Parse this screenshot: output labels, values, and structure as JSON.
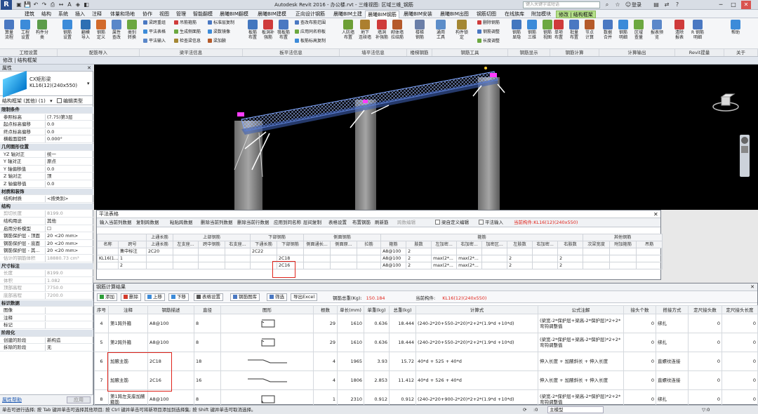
{
  "titlebar": {
    "app_title": "Autodesk Revit 2016 -",
    "doc_title": "办公楼.rvt - 三维视图: 区域三维_钢筋",
    "search_placeholder": "键入关键字或短语",
    "login": "登录",
    "quick_icons": [
      "open-icon",
      "save-icon",
      "undo-icon",
      "redo-icon",
      "print-icon",
      "measure-icon",
      "text-icon",
      "3d-icon",
      "section-icon"
    ]
  },
  "menu_tabs": [
    "建筑",
    "结构",
    "系统",
    "插入",
    "注释",
    "体量和场地",
    "协作",
    "视图",
    "管理",
    "智能翻模",
    "晨曦BIM翻模",
    "晨曦BIM建模",
    "正向设计钢筋",
    "晨曦BIM土建",
    "晨曦BIM钢筋",
    "晨曦BIM安装",
    "晨曦BIM出图",
    "钢筋切图",
    "在线族库",
    "附加模块",
    "修改 | 结构框架"
  ],
  "ribbon": {
    "big_buttons": [
      {
        "label": "算量\n流程",
        "color": "#4a78c2"
      },
      {
        "label": "工程\n设置",
        "color": "#3c8bd9"
      },
      {
        "label": "构件分类",
        "color": "#5c9c4a"
      },
      {
        "label": "钢筋\n设置",
        "color": "#3c8bd9"
      },
      {
        "label": "翻模\n导入",
        "color": "#2e6fb3"
      },
      {
        "label": "钢筋\n定义",
        "color": "#d26a2b"
      },
      {
        "label": "属性\n查改",
        "color": "#5a87c9"
      },
      {
        "label": "类别\n转换",
        "color": "#6ca840"
      },
      {
        "label": "板筋\n布置",
        "color": "#4377bf"
      },
      {
        "label": "板洞补\n强筋",
        "color": "#cf3b3b"
      },
      {
        "label": "筏板筋\n布置",
        "color": "#4a78c2"
      },
      {
        "label": "人防墙\n布置",
        "color": "#6d9f36"
      },
      {
        "label": "地下\n连续墙",
        "color": "#ac7f2f"
      },
      {
        "label": "墙洞\n补强筋",
        "color": "#cf3b3b"
      },
      {
        "label": "砌体墙\n拉结筋",
        "color": "#b55a2a"
      },
      {
        "label": "楼梯\n钢筋",
        "color": "#6b7fa8"
      },
      {
        "label": "通用\n工具",
        "color": "#5c8dc9"
      },
      {
        "label": "构件锁定",
        "color": "#a48733"
      },
      {
        "label": "钢筋\n显隐",
        "color": "#4377bf"
      },
      {
        "label": "钢筋\n三维",
        "color": "#3c8bd9"
      },
      {
        "label": "钢筋\n视图",
        "color": "#6ca840"
      },
      {
        "label": "单项\n布置",
        "color": "#cf3b3b"
      },
      {
        "label": "批量\n布置",
        "color": "#4a78c2"
      },
      {
        "label": "节点\n计算",
        "color": "#b55a2a"
      },
      {
        "label": "数据\n合并",
        "color": "#4a78c2"
      },
      {
        "label": "钢筋\n明细",
        "color": "#3c8bd9"
      },
      {
        "label": "区域\n查量",
        "color": "#6ca840"
      },
      {
        "label": "报表预览",
        "color": "#5a87c9"
      },
      {
        "label": "清除\n报表",
        "color": "#cf3b3b"
      },
      {
        "label": "R 钢筋明细",
        "color": "#4a78c2"
      },
      {
        "label": "帮助",
        "color": "#3c8bd9"
      }
    ],
    "small_buttons": [
      {
        "label": "梁跨重组",
        "color": "#4a78c2"
      },
      {
        "label": "平法表格",
        "color": "#3c8bd9"
      },
      {
        "label": "平法输入",
        "color": "#5a87c9"
      },
      {
        "label": "吊筋箍筋",
        "color": "#cf3b3b"
      },
      {
        "label": "生成侧面筋",
        "color": "#6ca840"
      },
      {
        "label": "检查梁信息",
        "color": "#a48733"
      },
      {
        "label": "标准层复制",
        "color": "#4a78c2"
      },
      {
        "label": "梁数镜像",
        "color": "#3c8bd9"
      },
      {
        "label": "梁加腋",
        "color": "#b55a2a"
      },
      {
        "label": "查改布筋范围",
        "color": "#4a78c2"
      },
      {
        "label": "应用同名称板",
        "color": "#6ca840"
      },
      {
        "label": "板筋标高复制",
        "color": "#3c8bd9"
      },
      {
        "label": "删除钢筋",
        "color": "#cf3b3b"
      },
      {
        "label": "钢筋调整",
        "color": "#4a78c2"
      },
      {
        "label": "长度调整",
        "color": "#6ca840"
      }
    ],
    "groups": [
      "工程设置",
      "配筋导入",
      "梁平法信息",
      "板平法信息",
      "墙平法信息",
      "楼梯钢筋",
      "钢筋工具",
      "钢筋显示",
      "钢筋计算",
      "计算输出",
      "Revit提量",
      "关于"
    ]
  },
  "context_bar": "修改 | 结构框架",
  "properties": {
    "title": "属性",
    "type_line1": "CX矩形梁",
    "type_line2": "KL16(12)(240x550)",
    "filter": "结构框架 (其他) (1)",
    "edit_type": "编辑类型",
    "rows": [
      {
        "label": "限制条件",
        "section": true
      },
      {
        "label": "参照标高",
        "value": "(7.75)第3层"
      },
      {
        "label": "起点标高偏移",
        "value": "0.0"
      },
      {
        "label": "终点标高偏移",
        "value": "0.0"
      },
      {
        "label": "横截面旋转",
        "value": "0.000°"
      },
      {
        "label": "几何图形位置",
        "section": true
      },
      {
        "label": "YZ 轴对正",
        "value": "统一"
      },
      {
        "label": "Y 轴对正",
        "value": "原点"
      },
      {
        "label": "Y 轴偏移值",
        "value": "0.0"
      },
      {
        "label": "Z 轴对正",
        "value": "顶"
      },
      {
        "label": "Z 轴偏移值",
        "value": "0.0"
      },
      {
        "label": "材质和装饰",
        "section": true
      },
      {
        "label": "结构材质",
        "value": "<按类别>"
      },
      {
        "label": "结构",
        "section": true
      },
      {
        "label": "剪切长度",
        "value": "8199.0",
        "dim": true
      },
      {
        "label": "结构用途",
        "value": "其他"
      },
      {
        "label": "启用分析模型",
        "value": "☐"
      },
      {
        "label": "钢筋保护层 - 顶面",
        "value": "20 <20 mm>"
      },
      {
        "label": "钢筋保护层 - 底面",
        "value": "20 <20 mm>"
      },
      {
        "label": "钢筋保护层 - 其...",
        "value": "20 <20 mm>"
      },
      {
        "label": "估计的钢筋体积",
        "value": "18880.73 cm³",
        "dim": true
      },
      {
        "label": "尺寸标注",
        "section": true
      },
      {
        "label": "长度",
        "value": "8199.0",
        "dim": true
      },
      {
        "label": "体积",
        "value": "1.082",
        "dim": true
      },
      {
        "label": "顶部高程",
        "value": "7750.0",
        "dim": true
      },
      {
        "label": "底部高程",
        "value": "7200.0",
        "dim": true
      },
      {
        "label": "标识数据",
        "section": true
      },
      {
        "label": "图像",
        "value": ""
      },
      {
        "label": "注释",
        "value": ""
      },
      {
        "label": "标记",
        "value": ""
      },
      {
        "label": "阶段化",
        "section": true
      },
      {
        "label": "创建的阶段",
        "value": "新构造"
      },
      {
        "label": "拆除的阶段",
        "value": "无"
      }
    ],
    "help_link": "属性帮助",
    "apply_button": "应用"
  },
  "table_panel": {
    "title": "平法表格",
    "toolbar": [
      "输入当前列数据",
      "复制跨数据",
      "粘贴跨数据",
      "删除当前列数据",
      "删除当前行数据",
      "应用到同名称",
      "层间复制",
      "表格设置",
      "布置钢筋",
      "刷新筋",
      "跨数编辑"
    ],
    "chk_custom": "梁自定义编辑",
    "chk_input": "平法输入",
    "current_prefix": "当前构件:",
    "current_member": "KL16(12)(240x550)",
    "groups": [
      "上通长筋",
      "上部钢筋",
      "下部钢筋",
      "侧面钢筋",
      "箍筋",
      "其他钢筋"
    ],
    "headers": [
      "名称",
      "跨号",
      "上通长筋",
      "左支座...",
      "跨中钢筋",
      "右支座...",
      "下通长筋",
      "下部钢筋",
      "侧面通长...",
      "侧面原...",
      "拉筋",
      "箍筋",
      "肢数",
      "左加密...",
      "右加密...",
      "加密区...",
      "左肢数",
      "右加密...",
      "右肢数",
      "次梁宽度",
      "附加箍筋",
      "吊筋"
    ],
    "rows": [
      [
        "",
        "集中标注",
        "2C20",
        "",
        "",
        "",
        "2C22",
        "",
        "",
        "",
        "",
        "A8@100",
        "2",
        "",
        "",
        "",
        "",
        "",
        "",
        "",
        "",
        ""
      ],
      [
        "KL16(1...",
        "1",
        "",
        "",
        "",
        "",
        "",
        "2C18",
        "",
        "",
        "",
        "A8@100",
        "2",
        "max(2*...",
        "max(2*...",
        "",
        "2",
        "",
        "2",
        "",
        "",
        ""
      ],
      [
        "",
        "2",
        "",
        "",
        "",
        "",
        "",
        "2C16",
        "",
        "",
        "",
        "A8@100",
        "2",
        "max(2*...",
        "max(2*...",
        "",
        "2",
        "",
        "2",
        "",
        "",
        ""
      ]
    ]
  },
  "result_panel": {
    "title": "钢筋计算结果",
    "buttons": [
      "添加",
      "删除",
      "上移",
      "下移",
      "表格设置",
      "钢筋图库",
      "筛选",
      "导出Excel"
    ],
    "total_weight_label": "钢筋总重(Kg):",
    "total_weight": "150.184",
    "current_label": "当前构件:",
    "current_member": "KL16(12)(240x550)",
    "headers": [
      "序号",
      "注释",
      "钢筋描述",
      "直径",
      "图形",
      "根数",
      "单长(mm)",
      "单重(kg)",
      "总重(kg)",
      "计算式",
      "公式注解",
      "接头个数",
      "搭接方式",
      "定尺接头数",
      "定尺接头长度"
    ],
    "rows": [
      {
        "no": "4",
        "note": "第1跨外箍",
        "desc": "A8@100",
        "dia": "8",
        "shape": "stirrup",
        "count": "29",
        "length": "1610",
        "unit": "0.636",
        "total": "18.444",
        "formula": "(240-2*20+550-2*20)*2+2*(1.9*d +10*d)",
        "annot": "(梁宽-2*保护层+梁高-2*保护层)*2+2*弯钩调整值",
        "joints": "0",
        "method": "绑扎",
        "fixed": "0",
        "fixed_len": "0"
      },
      {
        "no": "5",
        "note": "第2跨外箍",
        "desc": "A8@100",
        "dia": "8",
        "shape": "stirrup",
        "count": "29",
        "length": "1610",
        "unit": "0.636",
        "total": "18.444",
        "formula": "(240-2*20+550-2*20)*2+2*(1.9*d +10*d)",
        "annot": "(梁宽-2*保护层+梁高-2*保护层)*2+2*弯钩调整值",
        "joints": "0",
        "method": "绑扎",
        "fixed": "0",
        "fixed_len": "0"
      },
      {
        "no": "6",
        "note": "加腋主筋",
        "desc": "2C18",
        "dia": "18",
        "shape": "haunch",
        "count": "4",
        "length": "1965",
        "unit": "3.93",
        "total": "15.72",
        "formula": "40*d + 525 + 40*d",
        "annot": "伸入长度 + 加腋斜长 + 伸入长度",
        "joints": "0",
        "method": "直螺纹连接",
        "fixed": "0",
        "fixed_len": "0"
      },
      {
        "no": "7",
        "note": "加腋主筋",
        "desc": "2C16",
        "dia": "16",
        "shape": "haunch",
        "count": "4",
        "length": "1806",
        "unit": "2.853",
        "total": "11.412",
        "formula": "40*d + 526 + 40*d",
        "annot": "伸入长度 + 加腋斜长 + 伸入长度",
        "joints": "0",
        "method": "直螺纹连接",
        "fixed": "0",
        "fixed_len": "0"
      },
      {
        "no": "8",
        "note": "第1跨左支座加腋箍筋",
        "desc": "A8@100",
        "dia": "8",
        "shape": "stirrup2",
        "count": "1",
        "length": "2310",
        "unit": "0.912",
        "total": "0.912",
        "formula": "(240-2*20+900-2*20)*2+2*(1.9*d +10*d)",
        "annot": "(梁宽-2*保护层+梁高-2*保护层)*2+2*弯钩调整值",
        "joints": "0",
        "method": "绑扎",
        "fixed": "0",
        "fixed_len": "0"
      }
    ]
  },
  "status": {
    "text": "单击可进行选择; 按 Tab 键并单击可选择其他项目; 按 Ctrl 键并单击可将新项目添加到选择集; 按 Shift 键并单击可取消选择。",
    "zoom": ":0",
    "model": "主模型"
  },
  "colors": {
    "accent_red": "#e0241b",
    "highlight_tab": "#b5e08a",
    "viewport_bg": "#000000"
  }
}
